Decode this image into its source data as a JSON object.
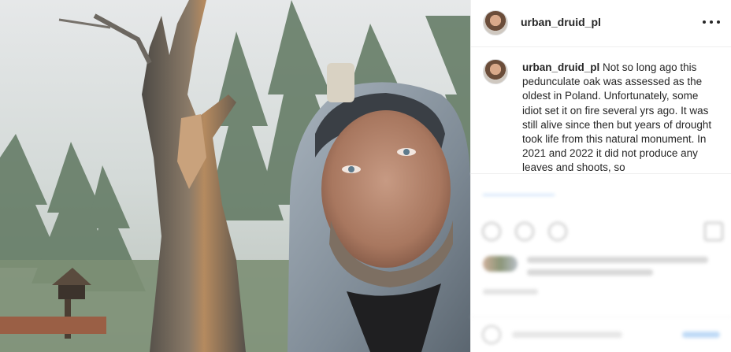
{
  "post": {
    "username": "urban_druid_pl",
    "caption": {
      "username": "urban_druid_pl",
      "text": "Not so long ago this pedunculate oak was assessed as the oldest in Poland. Unfortunately, some idiot set it on fire several yrs ago. It was still alive since then but years of drought took life from this natural monument. In 2021 and 2022 it did not produce any leaves and shoots, so"
    },
    "icons": {
      "more": "more-options-icon",
      "like": "heart-icon",
      "comment": "comment-icon",
      "share": "share-icon",
      "save": "bookmark-icon",
      "emoji": "emoji-icon"
    },
    "colors": {
      "text": "#262626",
      "link": "#0095f6",
      "divider": "#efefef"
    }
  }
}
